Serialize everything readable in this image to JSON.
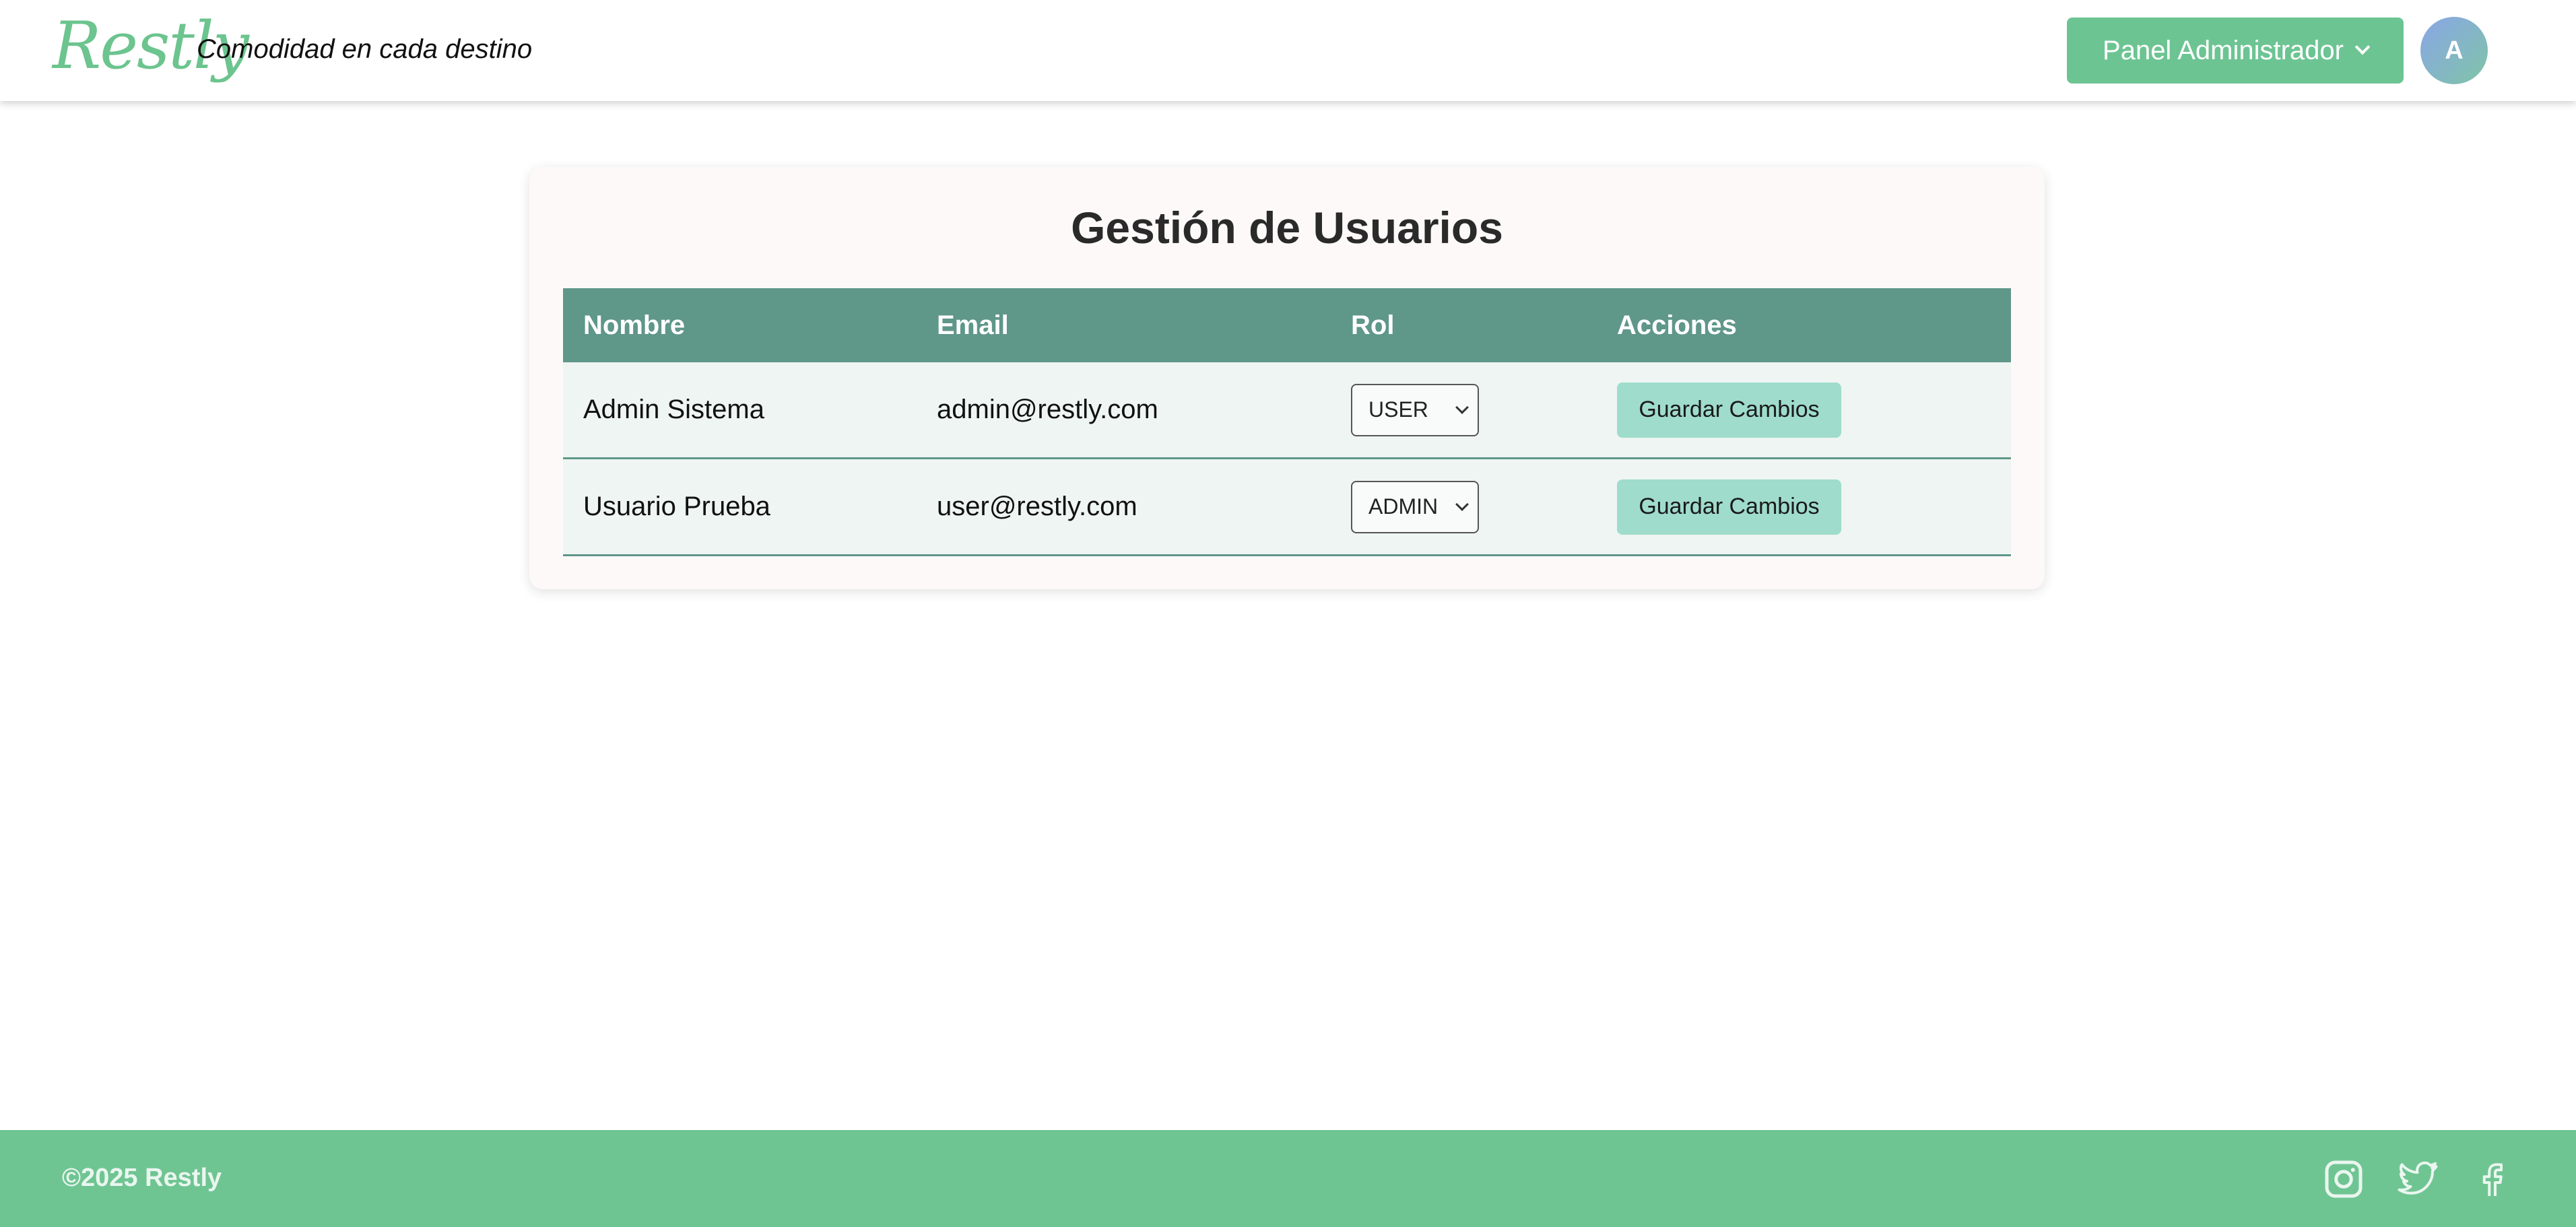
{
  "header": {
    "logo_text": "Restly",
    "tagline": "Comodidad en cada destino",
    "admin_menu_label": "Panel Administrador",
    "avatar_initial": "A"
  },
  "main": {
    "title": "Gestión de Usuarios",
    "table": {
      "headers": [
        "Nombre",
        "Email",
        "Rol",
        "Acciones"
      ],
      "rows": [
        {
          "name": "Admin Sistema",
          "email": "admin@restly.com",
          "role": "USER",
          "action": "Guardar Cambios"
        },
        {
          "name": "Usuario Prueba",
          "email": "user@restly.com",
          "role": "ADMIN",
          "action": "Guardar Cambios"
        }
      ]
    }
  },
  "footer": {
    "copyright": "©2025 Restly",
    "social_icons": [
      "instagram-icon",
      "twitter-icon",
      "facebook-icon"
    ]
  },
  "colors": {
    "brand_green": "#6fc592",
    "table_header": "#5f9789",
    "button_light": "#9fdccb"
  }
}
